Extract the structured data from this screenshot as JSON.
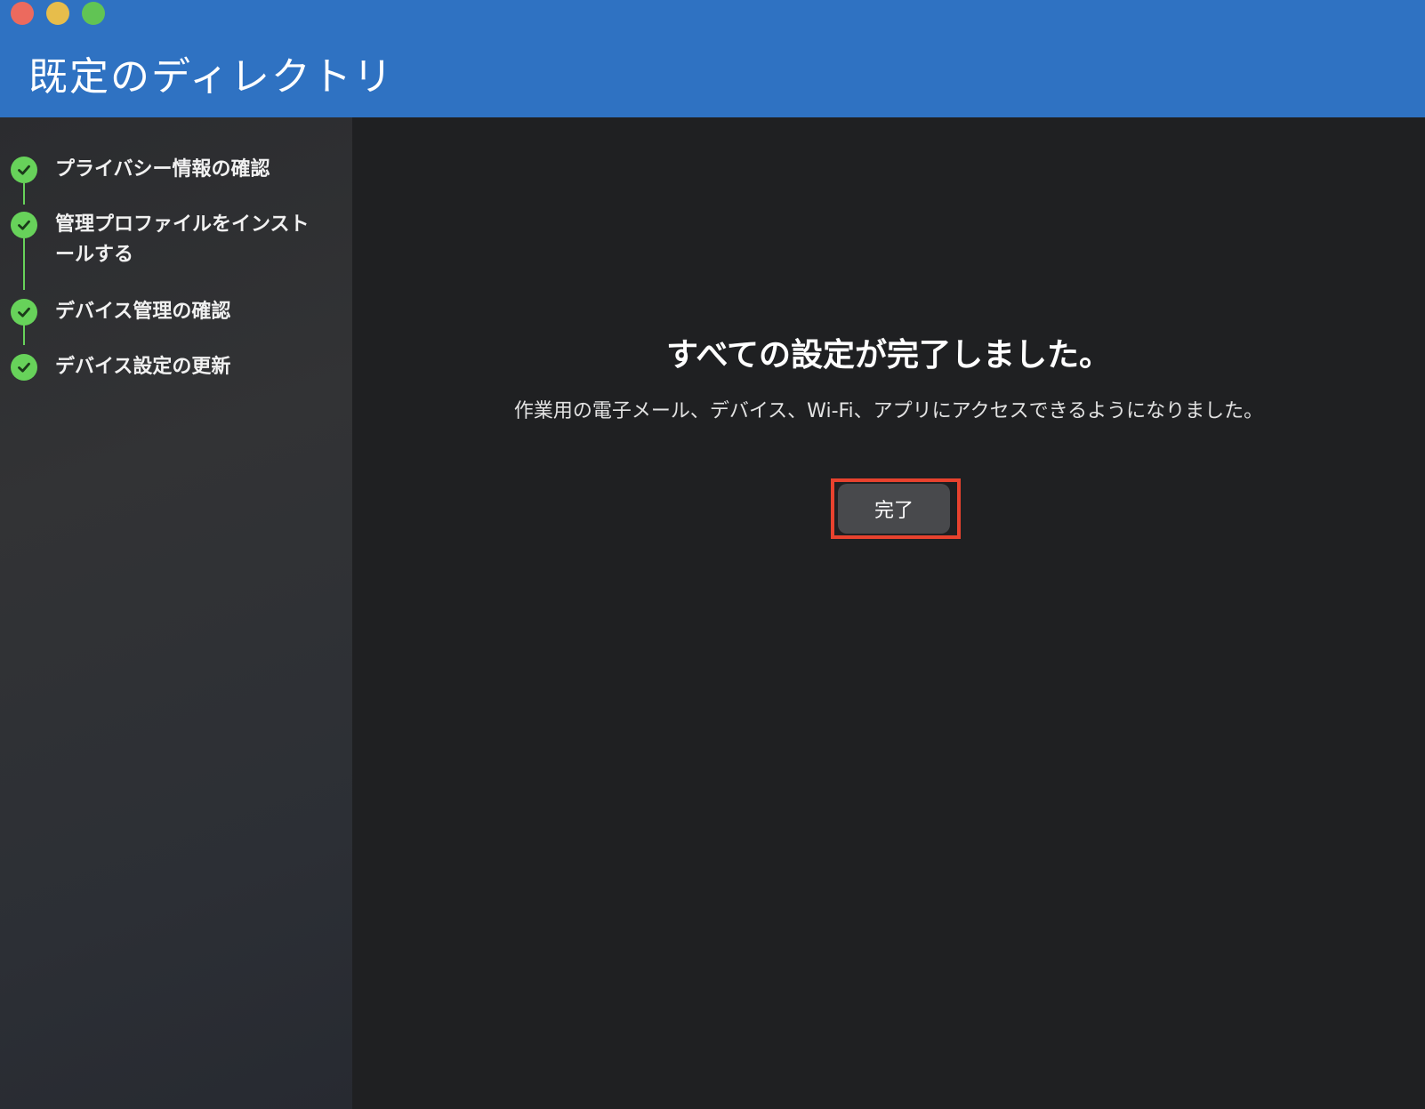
{
  "window": {
    "title": "既定のディレクトリ",
    "controls": [
      "close",
      "minimize",
      "maximize"
    ]
  },
  "sidebar": {
    "steps": [
      {
        "label": "プライバシー情報の確認",
        "status": "complete",
        "icon": "check-icon"
      },
      {
        "label": "管理プロファイルをインストールする",
        "status": "complete",
        "icon": "check-icon"
      },
      {
        "label": "デバイス管理の確認",
        "status": "complete",
        "icon": "check-icon"
      },
      {
        "label": "デバイス設定の更新",
        "status": "complete",
        "icon": "check-icon"
      }
    ]
  },
  "main": {
    "title": "すべての設定が完了しました。",
    "description": "作業用の電子メール、デバイス、Wi-Fi、アプリにアクセスできるようになりました。",
    "done_button": "完了"
  },
  "colors": {
    "header": "#2f72c2",
    "check": "#67d25a",
    "highlight": "#e8422e",
    "background": "#1f2022"
  }
}
